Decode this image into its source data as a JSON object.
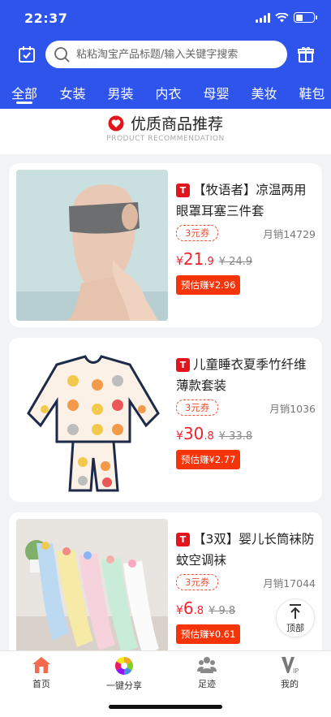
{
  "status": {
    "time": "22:37"
  },
  "search": {
    "placeholder": "粘粘淘宝产品标题/输入关键字搜索"
  },
  "tabs": [
    {
      "label": "全部",
      "active": true
    },
    {
      "label": "女装"
    },
    {
      "label": "男装"
    },
    {
      "label": "内衣"
    },
    {
      "label": "母婴"
    },
    {
      "label": "美妆"
    },
    {
      "label": "鞋包"
    }
  ],
  "section": {
    "title": "优质商品推荐",
    "subtitle": "PRODUCT RECOMMENDATION"
  },
  "products": [
    {
      "badge": "T",
      "title": "【牧语者】凉温两用眼罩耳塞三件套",
      "coupon": "3元券",
      "monthly": "月销14729",
      "currency": "¥",
      "price_int": "21",
      "price_dec": ".9",
      "orig": "¥ 24.9",
      "earn": "预估赚¥2.96"
    },
    {
      "badge": "T",
      "title": "儿童睡衣夏季竹纤维薄款套装",
      "coupon": "3元券",
      "monthly": "月销1036",
      "currency": "¥",
      "price_int": "30",
      "price_dec": ".8",
      "orig": "¥ 33.8",
      "earn": "预估赚¥2.77"
    },
    {
      "badge": "T",
      "title": "【3双】婴儿长筒袜防蚊空调袜",
      "coupon": "3元券",
      "monthly": "月销17044",
      "currency": "¥",
      "price_int": "6",
      "price_dec": ".8",
      "orig": "¥ 9.8",
      "earn": "预估赚¥0.61"
    }
  ],
  "back_to_top": {
    "label": "顶部"
  },
  "bottom_nav": [
    {
      "label": "首页",
      "icon": "home-icon"
    },
    {
      "label": "一键分享",
      "icon": "share-pinwheel-icon"
    },
    {
      "label": "足迹",
      "icon": "footprint-icon"
    },
    {
      "label": "我的",
      "icon": "vip-icon"
    }
  ],
  "colors": {
    "brand": "#2f54eb",
    "price": "#f5222d",
    "earn_bg": "#f5340a",
    "badge": "#e3151c"
  }
}
